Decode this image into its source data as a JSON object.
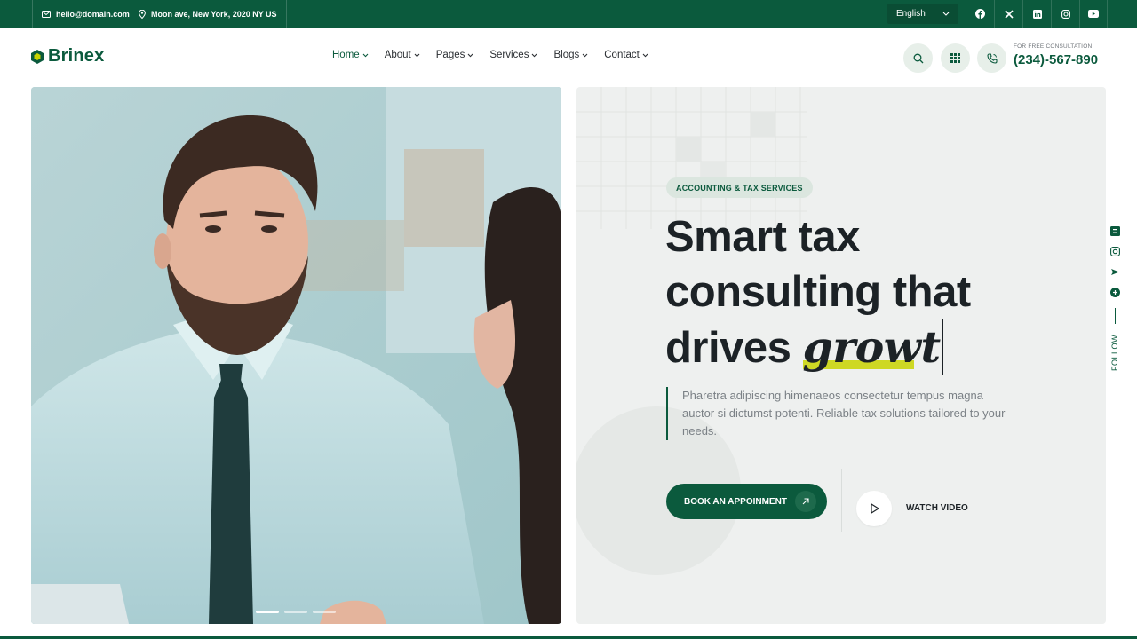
{
  "topbar": {
    "email": "hello@domain.com",
    "address": "Moon ave, New York, 2020 NY US",
    "language": "English",
    "socials": [
      "facebook-icon",
      "x-icon",
      "linkedin-icon",
      "instagram-icon",
      "youtube-icon"
    ]
  },
  "header": {
    "logo": "Brinex",
    "nav": [
      {
        "label": "Home",
        "active": true
      },
      {
        "label": "About"
      },
      {
        "label": "Pages"
      },
      {
        "label": "Services"
      },
      {
        "label": "Blogs"
      },
      {
        "label": "Contact"
      }
    ],
    "consult_label": "FOR FREE CONSULTATION",
    "phone": "(234)-567-890"
  },
  "hero": {
    "tag": "ACCOUNTING & TAX SERVICES",
    "heading_line1": "Smart tax",
    "heading_line2": "consulting that",
    "heading_line3": "drives",
    "heading_accent": "growt",
    "description": "Pharetra adipiscing himenaeos consectetur tempus magna auctor si dictumst potenti. Reliable tax solutions tailored to your needs.",
    "book_label": "BOOK AN APPOINMENT",
    "watch_label": "WATCH VIDEO",
    "slides": 3,
    "active_slide": 1
  },
  "follow": {
    "label": "FOLLOW",
    "icons": [
      "blogger-icon",
      "instagram-icon",
      "tripadvisor-icon",
      "pinterest-icon"
    ]
  },
  "colors": {
    "brand": "#0b5a3d",
    "accent": "#c8d400",
    "panel": "#eef0ef"
  }
}
